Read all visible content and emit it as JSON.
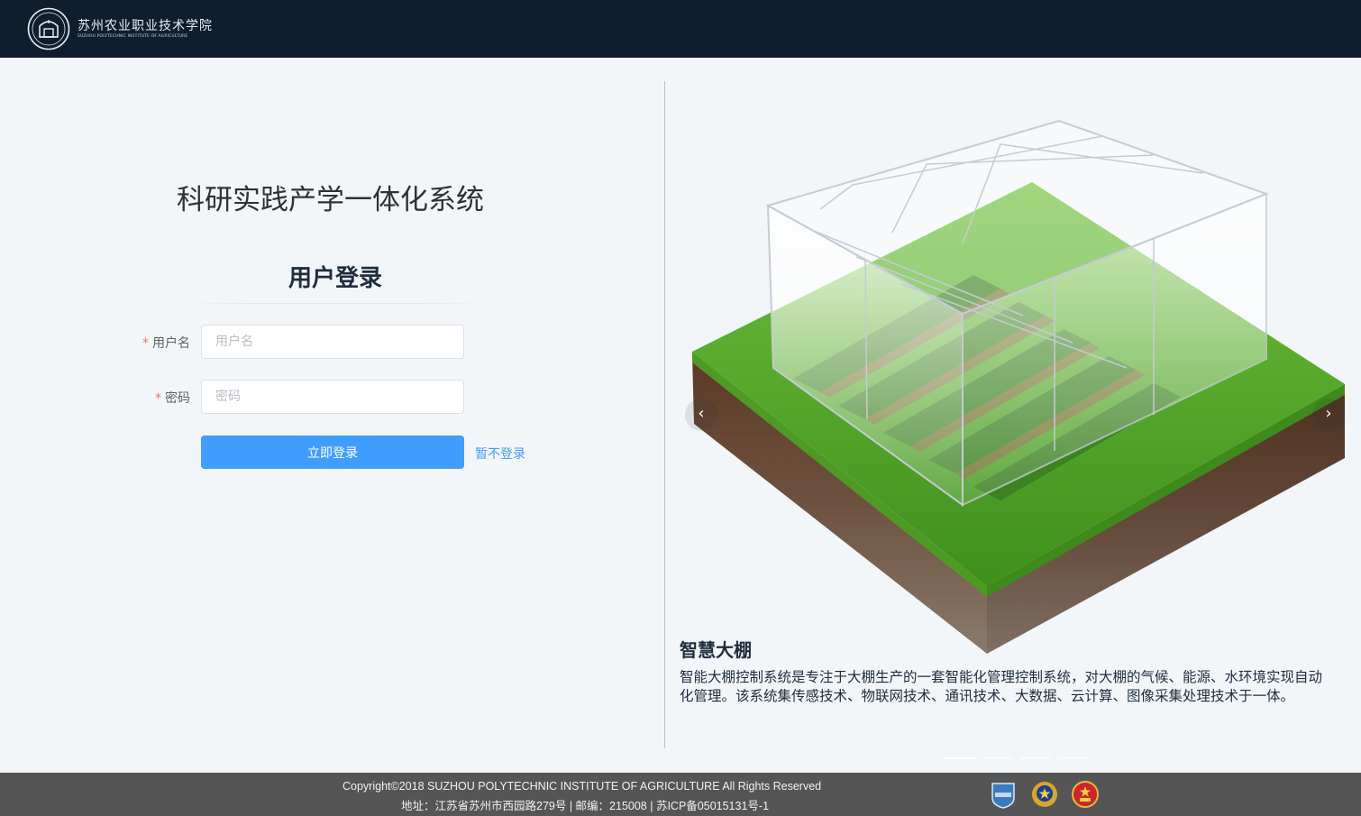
{
  "header": {
    "school_name_cn": "苏州农业职业技术学院",
    "school_name_en": "SUZHOU POLYTECHNIC INSTITUTE OF AGRICULTURE",
    "logo_icon": "school-emblem-icon",
    "bg_color": "#0f1e2e"
  },
  "login": {
    "system_title": "科研实践产学一体化系统",
    "title": "用户登录",
    "required_mark": "*",
    "username_label": "用户名",
    "username_placeholder": "用户名",
    "username_value": "",
    "password_label": "密码",
    "password_placeholder": "密码",
    "password_value": "",
    "submit_label": "立即登录",
    "skip_label": "暂不登录",
    "primary_color": "#409eff"
  },
  "carousel": {
    "prev_icon": "chevron-left-icon",
    "next_icon": "chevron-right-icon",
    "prev_glyph": "‹",
    "next_glyph": "›",
    "slide_count": 4,
    "active_index": 0,
    "slide": {
      "title": "智慧大棚",
      "description": "智能大棚控制系统是专注于大棚生产的一套智能化管理控制系统，对大棚的气候、能源、水环境实现自动化管理。该系统集传感技术、物联网技术、通讯技术、大数据、云计算、图像采集处理技术于一体。",
      "image_icon": "greenhouse-illustration"
    }
  },
  "footer": {
    "copyright": "Copyright©2018 SUZHOU POLYTECHNIC INSTITUTE OF AGRICULTURE All Rights Reserved",
    "address": "地址：江苏省苏州市西园路279号 | 邮编：215008  | 苏ICP备05015131号-1",
    "badges": [
      "shield-badge-icon",
      "police-emblem-icon",
      "national-emblem-icon"
    ]
  }
}
